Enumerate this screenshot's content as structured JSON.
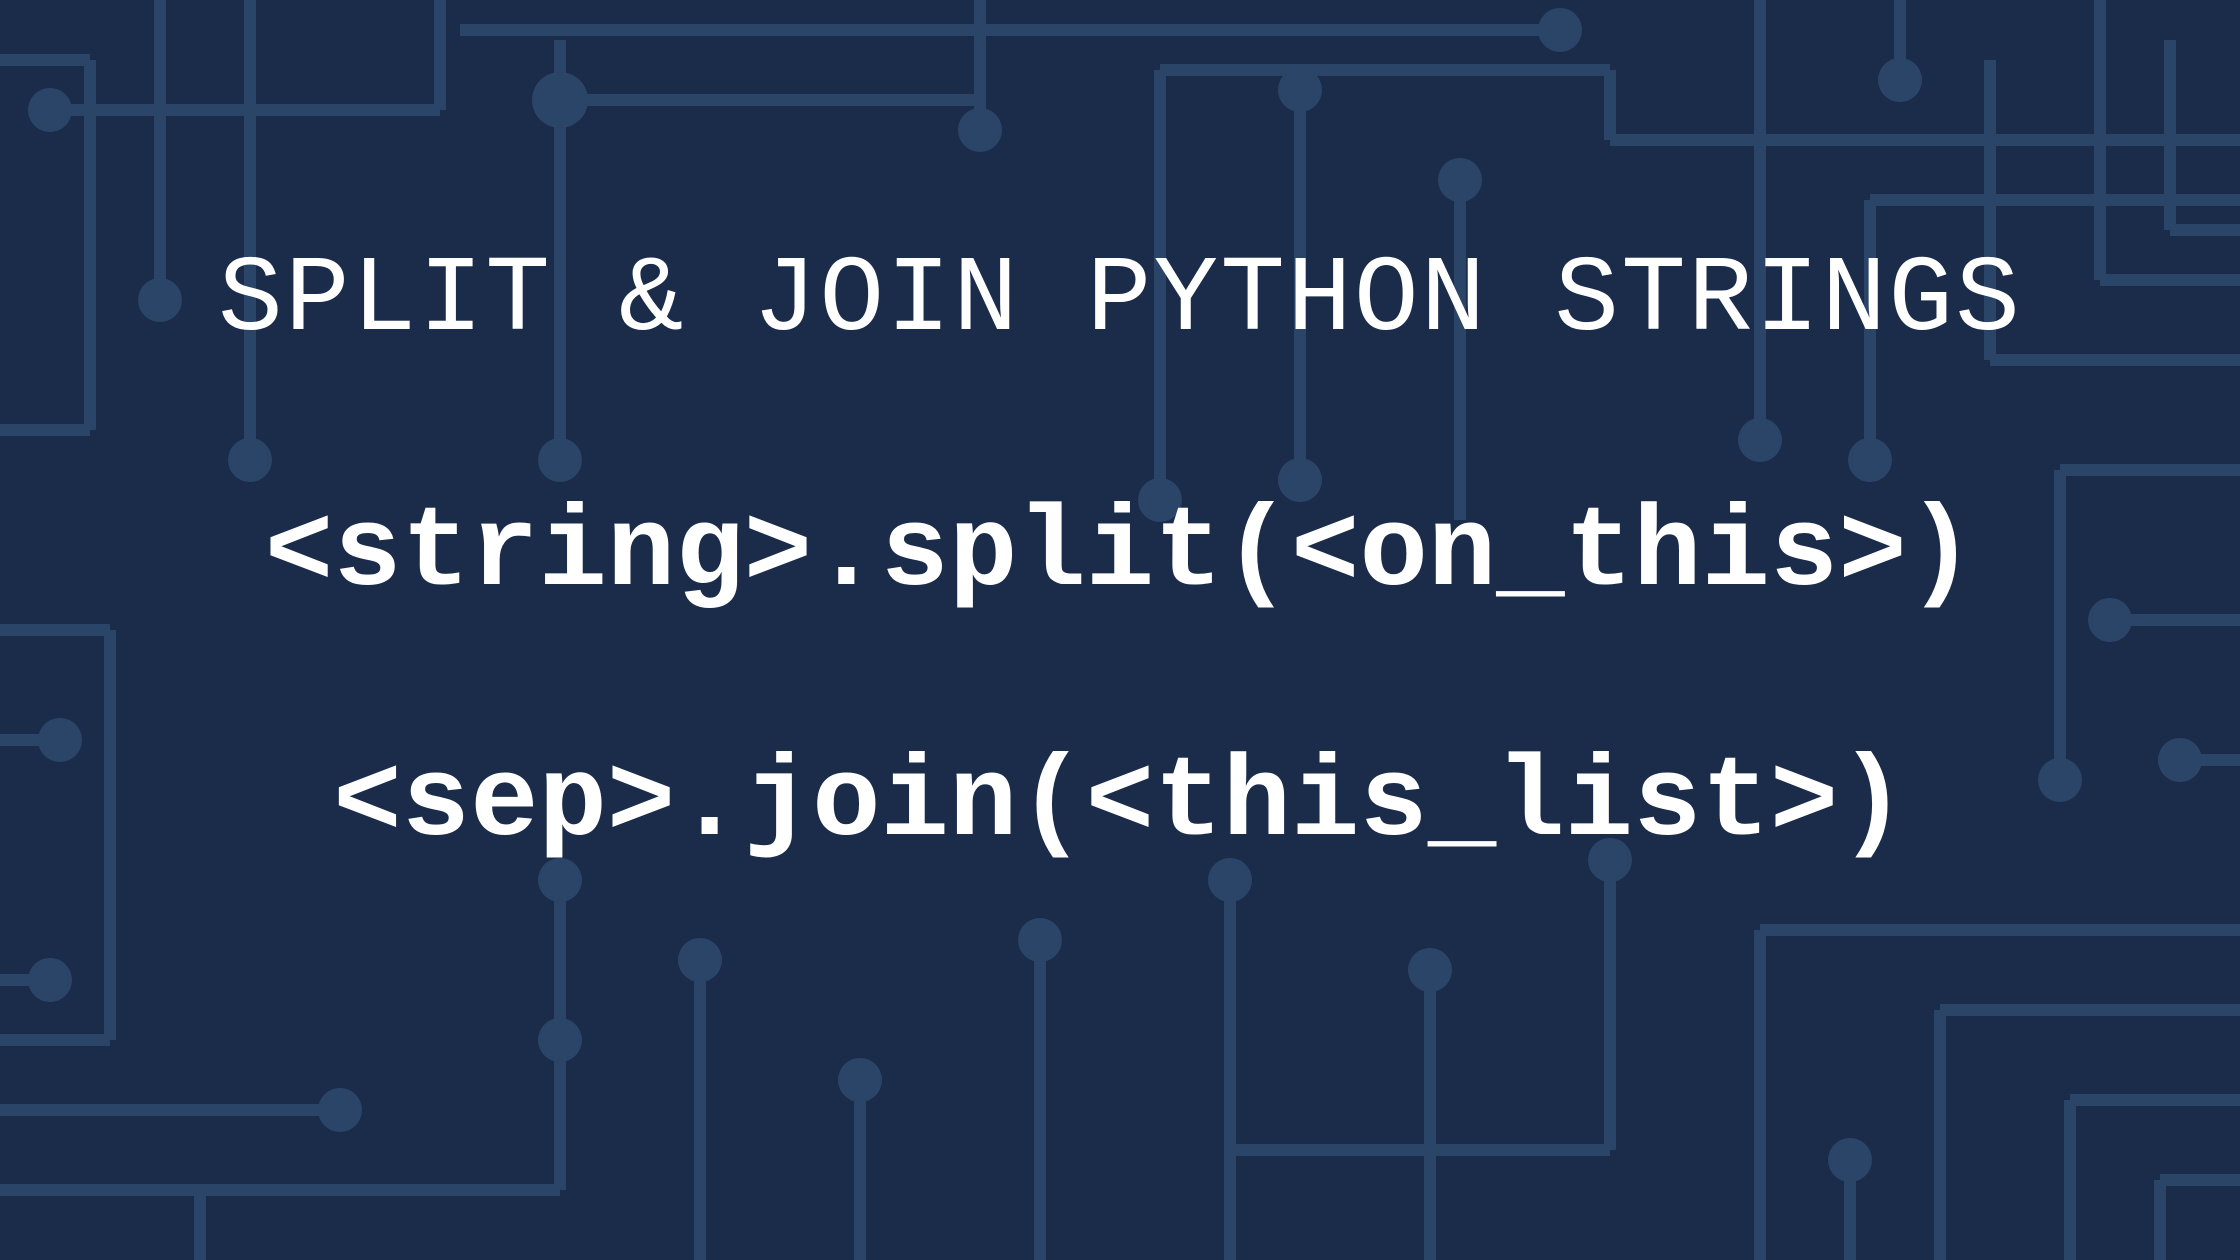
{
  "title": "SPLIT & JOIN PYTHON STRINGS",
  "lines": {
    "split": "<string>.split(<on_this>)",
    "join": "<sep>.join(<this_list>)"
  }
}
